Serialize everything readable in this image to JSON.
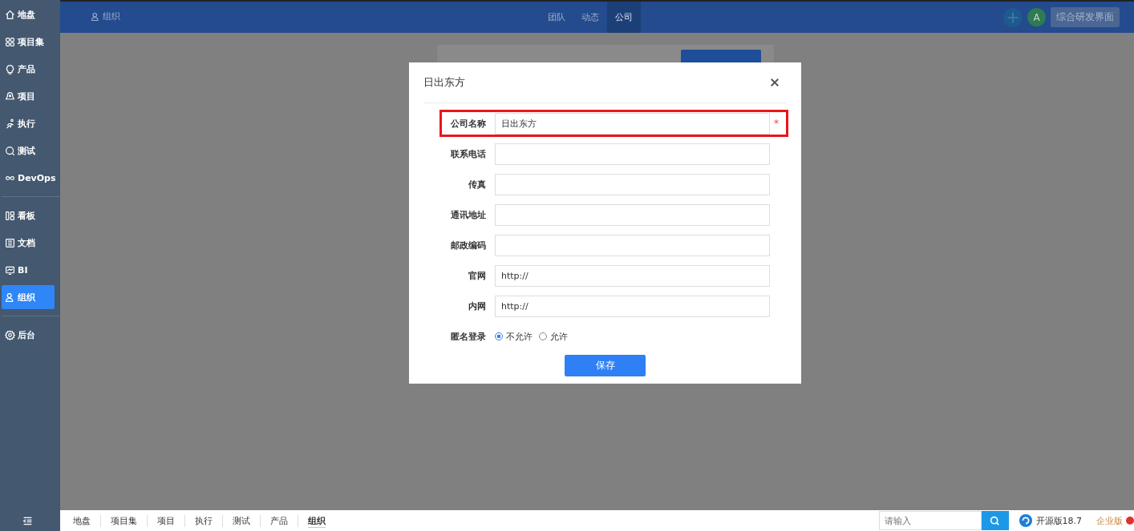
{
  "sidebar": {
    "groups": [
      [
        {
          "label": "地盘",
          "selected": false
        },
        {
          "label": "项目集",
          "selected": false
        },
        {
          "label": "产品",
          "selected": false
        },
        {
          "label": "项目",
          "selected": false
        },
        {
          "label": "执行",
          "selected": false
        },
        {
          "label": "测试",
          "selected": false
        },
        {
          "label": "DevOps",
          "selected": false
        }
      ],
      [
        {
          "label": "看板",
          "selected": false
        },
        {
          "label": "文档",
          "selected": false
        },
        {
          "label": "BI",
          "selected": false
        },
        {
          "label": "组织",
          "selected": true
        }
      ],
      [
        {
          "label": "后台",
          "selected": false
        }
      ]
    ]
  },
  "top_bar": {
    "section": "组织",
    "tabs": [
      {
        "label": "团队",
        "selected": false
      },
      {
        "label": "动态",
        "selected": false
      },
      {
        "label": "公司",
        "selected": true
      }
    ],
    "avatar": "A",
    "workspace_button": "综合研发界面"
  },
  "dialog": {
    "title": "日出东方",
    "fields": [
      {
        "kind": "text",
        "label": "公司名称",
        "value": "日出东方",
        "required_mark": "*",
        "highlighted": true
      },
      {
        "kind": "text",
        "label": "联系电话",
        "highlighted": false
      },
      {
        "kind": "text",
        "label": "传真",
        "highlighted": false
      },
      {
        "kind": "text",
        "label": "通讯地址",
        "highlighted": false
      },
      {
        "kind": "text",
        "label": "邮政编码",
        "highlighted": false
      },
      {
        "kind": "text",
        "label": "官网",
        "value": "http://",
        "highlighted": false
      },
      {
        "kind": "text",
        "label": "内网",
        "value": "http://",
        "highlighted": false
      },
      {
        "kind": "radio",
        "label": "匿名登录",
        "highlighted": false,
        "options": [
          {
            "label": "不允许",
            "selected": true
          },
          {
            "label": "允许",
            "selected": false
          }
        ]
      }
    ],
    "save_button": "保存"
  },
  "bottom_bar": {
    "tabs": [
      {
        "label": "地盘",
        "selected": false
      },
      {
        "label": "项目集",
        "selected": false
      },
      {
        "label": "项目",
        "selected": false
      },
      {
        "label": "执行",
        "selected": false
      },
      {
        "label": "测试",
        "selected": false
      },
      {
        "label": "产品",
        "selected": false
      },
      {
        "label": "组织",
        "selected": true
      }
    ],
    "search": {
      "placeholder": "请输入"
    },
    "version": "开源版18.7",
    "upgrade_link": "企业版"
  }
}
